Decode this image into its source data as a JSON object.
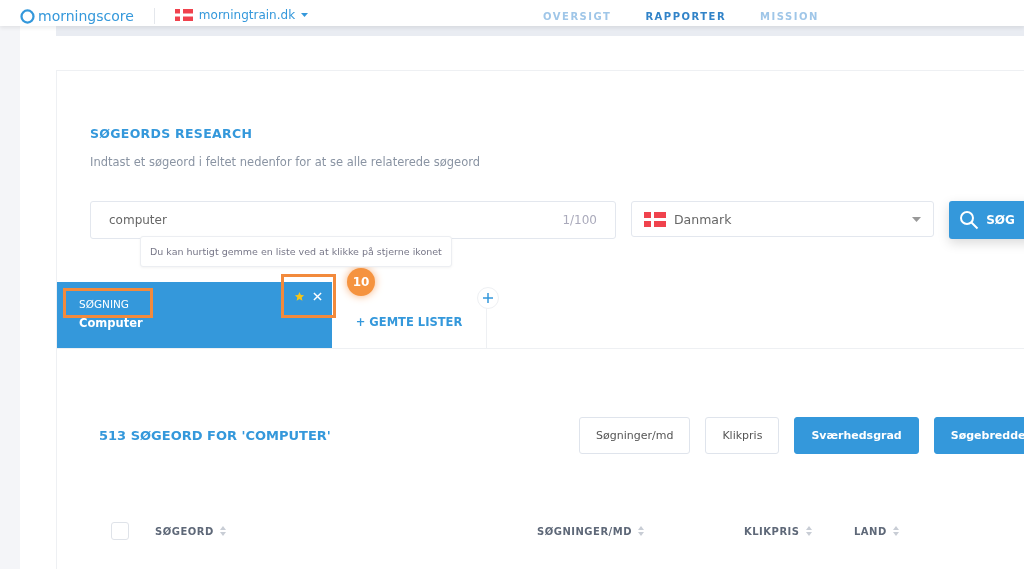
{
  "header": {
    "logo": "morningscore",
    "site": "morningtrain.dk",
    "nav": [
      {
        "label": "OVERSIGT",
        "selected": false
      },
      {
        "label": "RAPPORTER",
        "selected": true
      },
      {
        "label": "MISSION",
        "selected": false
      }
    ]
  },
  "research": {
    "title": "SØGEORDS RESEARCH",
    "subtitle": "Indtast et søgeord i feltet nedenfor for at se alle relaterede søgeord",
    "query": "computer",
    "counter": "1/100",
    "country": "Danmark",
    "search_button": "SØG"
  },
  "tooltip": "Du kan hurtigt gemme en liste ved at klikke på stjerne ikonet",
  "step_badge": "10",
  "tabs": [
    {
      "kind": "search",
      "label": "SØGNING",
      "sub": "Computer",
      "selected": true
    },
    {
      "kind": "saved",
      "label": "+ GEMTE LISTER",
      "selected": false
    }
  ],
  "results": {
    "title": "513 SØGEORD FOR 'COMPUTER'",
    "filters": [
      {
        "label": "Søgninger/md",
        "selected": false
      },
      {
        "label": "Klikpris",
        "selected": false
      },
      {
        "label": "Sværhedsgrad",
        "selected": true
      },
      {
        "label": "Søgebredde",
        "selected": true
      }
    ]
  },
  "table": {
    "select_all_checked": false,
    "columns": [
      "SØGEORD",
      "SØGNINGER/MD",
      "KLIKPRIS",
      "LAND"
    ]
  }
}
